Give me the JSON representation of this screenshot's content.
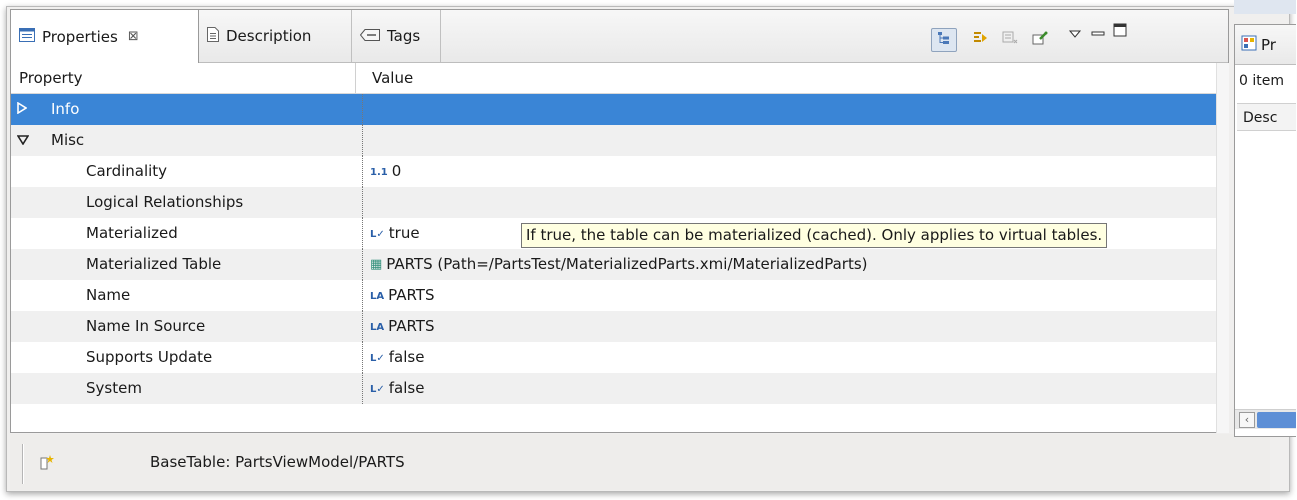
{
  "tabs": {
    "properties": "Properties",
    "properties_close": "⊠",
    "description": "Description",
    "tags": "Tags"
  },
  "table": {
    "col_property": "Property",
    "col_value": "Value",
    "rows": [
      {
        "name": "Info",
        "value": ""
      },
      {
        "name": "Misc",
        "value": ""
      },
      {
        "name": "Cardinality",
        "value": "0",
        "icon": "1.1"
      },
      {
        "name": "Logical Relationships",
        "value": ""
      },
      {
        "name": "Materialized",
        "value": "true",
        "icon": "L✓"
      },
      {
        "name": "Materialized Table",
        "value": "PARTS (Path=/PartsTest/MaterializedParts.xmi/MaterializedParts)",
        "icon": "▦"
      },
      {
        "name": "Name",
        "value": "PARTS",
        "icon": "LA"
      },
      {
        "name": "Name In Source",
        "value": "PARTS",
        "icon": "LA"
      },
      {
        "name": "Supports Update",
        "value": "false",
        "icon": "L✓"
      },
      {
        "name": "System",
        "value": "false",
        "icon": "L✓"
      }
    ]
  },
  "tooltip": "If true, the table can be materialized (cached). Only applies to virtual tables.",
  "status": {
    "text": "BaseTable: PartsViewModel/PARTS"
  },
  "side_view": {
    "tab_label": "Pr",
    "count": "0 item",
    "header": "Desc"
  }
}
